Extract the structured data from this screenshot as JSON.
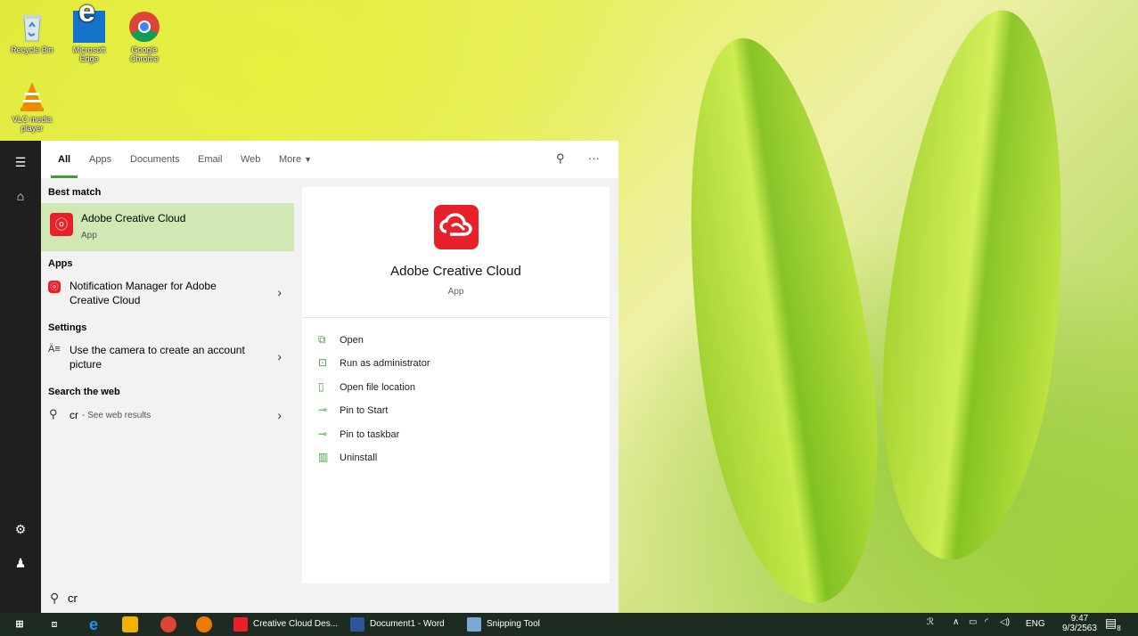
{
  "desktop": {
    "icons": [
      {
        "label": "Recycle Bin"
      },
      {
        "label": "Microsoft Edge"
      },
      {
        "label": "Google Chrome"
      },
      {
        "label": "VLC media player"
      }
    ]
  },
  "search": {
    "tabs": [
      "All",
      "Apps",
      "Documents",
      "Email",
      "Web",
      "More"
    ],
    "more_arrow": "▼",
    "sections": {
      "best_match": "Best match",
      "apps": "Apps",
      "settings": "Settings",
      "web": "Search the web"
    },
    "best_match": {
      "title": "Adobe Creative Cloud",
      "subtitle": "App"
    },
    "apps_item": {
      "line1": "Notification Manager for Adobe",
      "line2": "Creative Cloud"
    },
    "settings_item": {
      "line1": "Use the camera to create an account",
      "line2": "picture"
    },
    "web_item": {
      "query": "cr",
      "hint": "- See web results"
    },
    "detail": {
      "title": "Adobe Creative Cloud",
      "subtitle": "App",
      "actions": [
        "Open",
        "Run as administrator",
        "Open file location",
        "Pin to Start",
        "Pin to taskbar",
        "Uninstall"
      ]
    },
    "query": "cr",
    "ellipsis": "···"
  },
  "taskbar": {
    "apps": [
      {
        "label": "Creative Cloud Des..."
      },
      {
        "label": "Document1 - Word"
      },
      {
        "label": "Snipping Tool"
      }
    ],
    "lang": "ENG",
    "time": "9:47",
    "date": "9/3/2563",
    "notif_count": "8"
  },
  "colors": {
    "accent": "#41a030",
    "adobe_red": "#e8202a",
    "highlight": "#cfe8b4"
  }
}
